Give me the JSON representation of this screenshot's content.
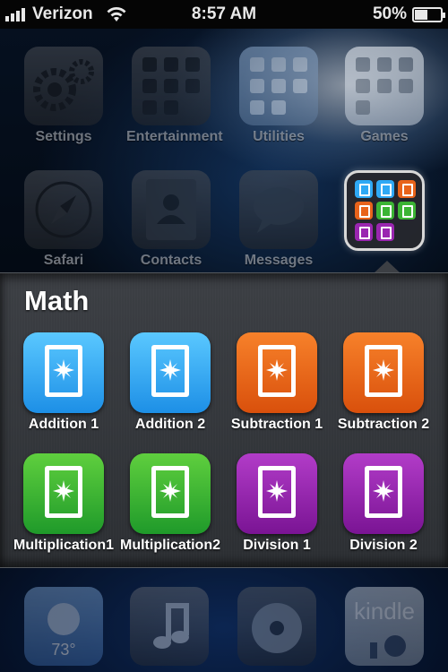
{
  "status_bar": {
    "carrier": "Verizon",
    "time": "8:57 AM",
    "battery": "50%",
    "battery_level": 0.5
  },
  "home_apps": [
    {
      "label": "Settings"
    },
    {
      "label": "Entertainment"
    },
    {
      "label": "Utilities"
    },
    {
      "label": "Games"
    },
    {
      "label": "Safari"
    },
    {
      "label": "Contacts"
    },
    {
      "label": "Messages"
    }
  ],
  "folder": {
    "title": "Math",
    "apps": [
      {
        "label": "Addition 1",
        "color": "#2fa9f5"
      },
      {
        "label": "Addition 2",
        "color": "#2fa9f5"
      },
      {
        "label": "Subtraction 1",
        "color": "#e8631a"
      },
      {
        "label": "Subtraction 2",
        "color": "#e8631a"
      },
      {
        "label": "Multiplication1",
        "color": "#3cb434"
      },
      {
        "label": "Multiplication2",
        "color": "#3cb434"
      },
      {
        "label": "Division 1",
        "color": "#9a26b0"
      },
      {
        "label": "Division 2",
        "color": "#9a26b0"
      }
    ]
  },
  "dock": {
    "weather_temp": "73°",
    "kindle_label": "kindle"
  }
}
